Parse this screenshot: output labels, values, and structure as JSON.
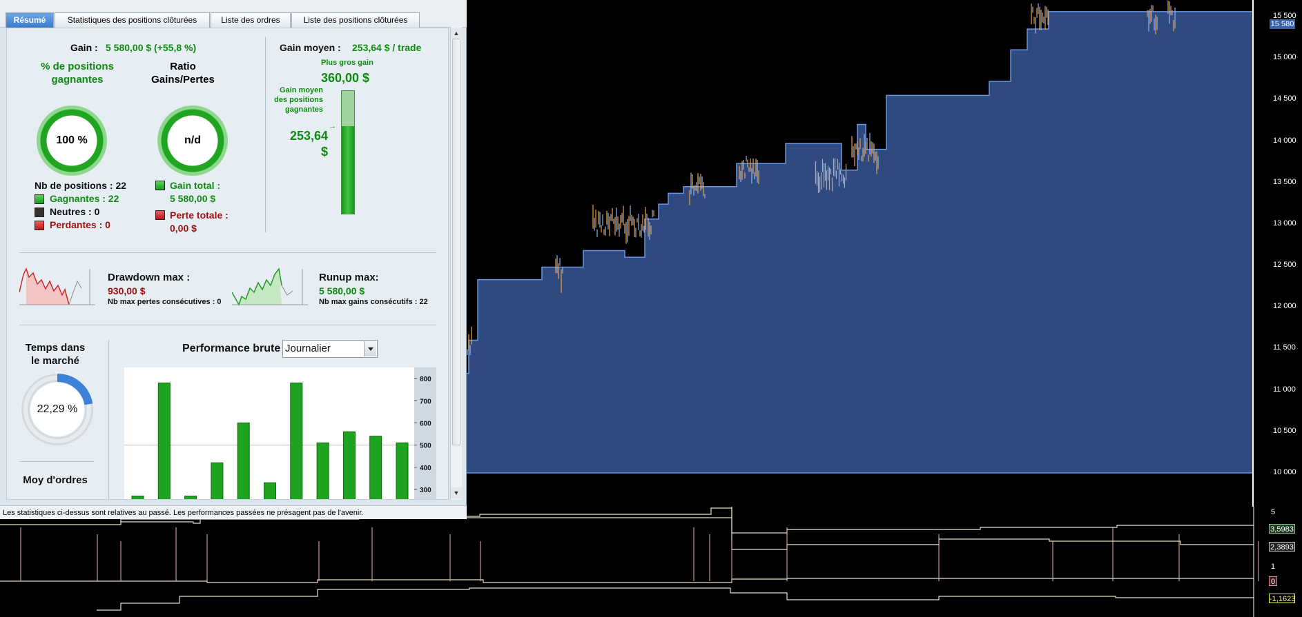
{
  "tabs": [
    {
      "label": "Résumé",
      "active": true
    },
    {
      "label": "Statistiques des positions clôturées",
      "active": false
    },
    {
      "label": "Liste des ordres",
      "active": false
    },
    {
      "label": "Liste des positions clôturées",
      "active": false
    }
  ],
  "summary": {
    "gain_label": "Gain :",
    "gain_value": "5 580,00 $ (+55,8 %)",
    "avg_gain_label": "Gain moyen :",
    "avg_gain_value": "253,64 $ / trade",
    "win_pct_title": "% de positions gagnantes",
    "win_pct_value": "100 %",
    "ratio_title": "Ratio Gains/Pertes",
    "ratio_value": "n/d",
    "nb_positions": "Nb de positions : 22",
    "winning": "Gagnantes : 22",
    "neutral": "Neutres : 0",
    "losing": "Perdantes : 0",
    "total_gain_label": "Gain total :",
    "total_gain_value": "5 580,00 $",
    "total_loss_label": "Perte totale :",
    "total_loss_value": "0,00 $",
    "biggest_gain_label": "Plus gros gain",
    "biggest_gain_value": "360,00 $",
    "avg_win_label": "Gain moyen des positions gagnantes",
    "avg_win_value": "253,64 $"
  },
  "drawdown": {
    "label": "Drawdown max :",
    "value": "930,00 $",
    "consec": "Nb max pertes consécutives : 0"
  },
  "runup": {
    "label": "Runup max:",
    "value": "5 580,00 $",
    "consec": "Nb max gains consécutifs : 22"
  },
  "market_time": {
    "title": "Temps dans le marché",
    "value": "22,29 %",
    "fraction": 0.2229
  },
  "avg_orders": {
    "title": "Moy d'ordres"
  },
  "performance": {
    "label": "Performance brute",
    "period": "Journalier"
  },
  "colors": {
    "equity_fill": "#2f4a7e",
    "equity_line": "#6a95e6",
    "volatility": "#f0a040",
    "bar_green": "#1ea41e"
  },
  "chart_data": [
    {
      "type": "bar",
      "title": "Performance brute",
      "ylim": [
        250,
        850
      ],
      "yticks": [
        800,
        700,
        600,
        500,
        400,
        300
      ],
      "grid": "y=500",
      "series": [
        {
          "values": [
            270,
            780,
            270,
            420,
            600,
            330,
            780,
            510,
            560,
            540,
            510
          ]
        }
      ]
    },
    {
      "type": "area",
      "ylim": [
        10000,
        15700
      ],
      "yticks": [
        15500,
        15000,
        14500,
        14000,
        13500,
        13000,
        12500,
        12000,
        11500,
        11000,
        10500,
        10000
      ],
      "last_value": "15 580",
      "x": [
        0,
        3,
        16,
        101,
        109,
        169,
        202,
        229,
        258,
        278,
        292,
        314,
        346,
        391,
        410,
        462,
        529,
        543,
        566,
        578,
        608,
        694,
        757,
        788,
        812,
        843,
        1140
      ],
      "y": [
        11200,
        11600,
        12330,
        12330,
        12480,
        12680,
        12680,
        12600,
        13060,
        13240,
        13370,
        13450,
        13450,
        13730,
        13730,
        13970,
        13970,
        13650,
        14200,
        13900,
        14550,
        14550,
        14720,
        15100,
        15350,
        15560,
        15560
      ]
    },
    {
      "type": "line",
      "labels": [
        "3,5983",
        "2,3893",
        "0",
        "-1,1623"
      ],
      "axis_ticks": [
        "5",
        "1"
      ]
    }
  ]
}
